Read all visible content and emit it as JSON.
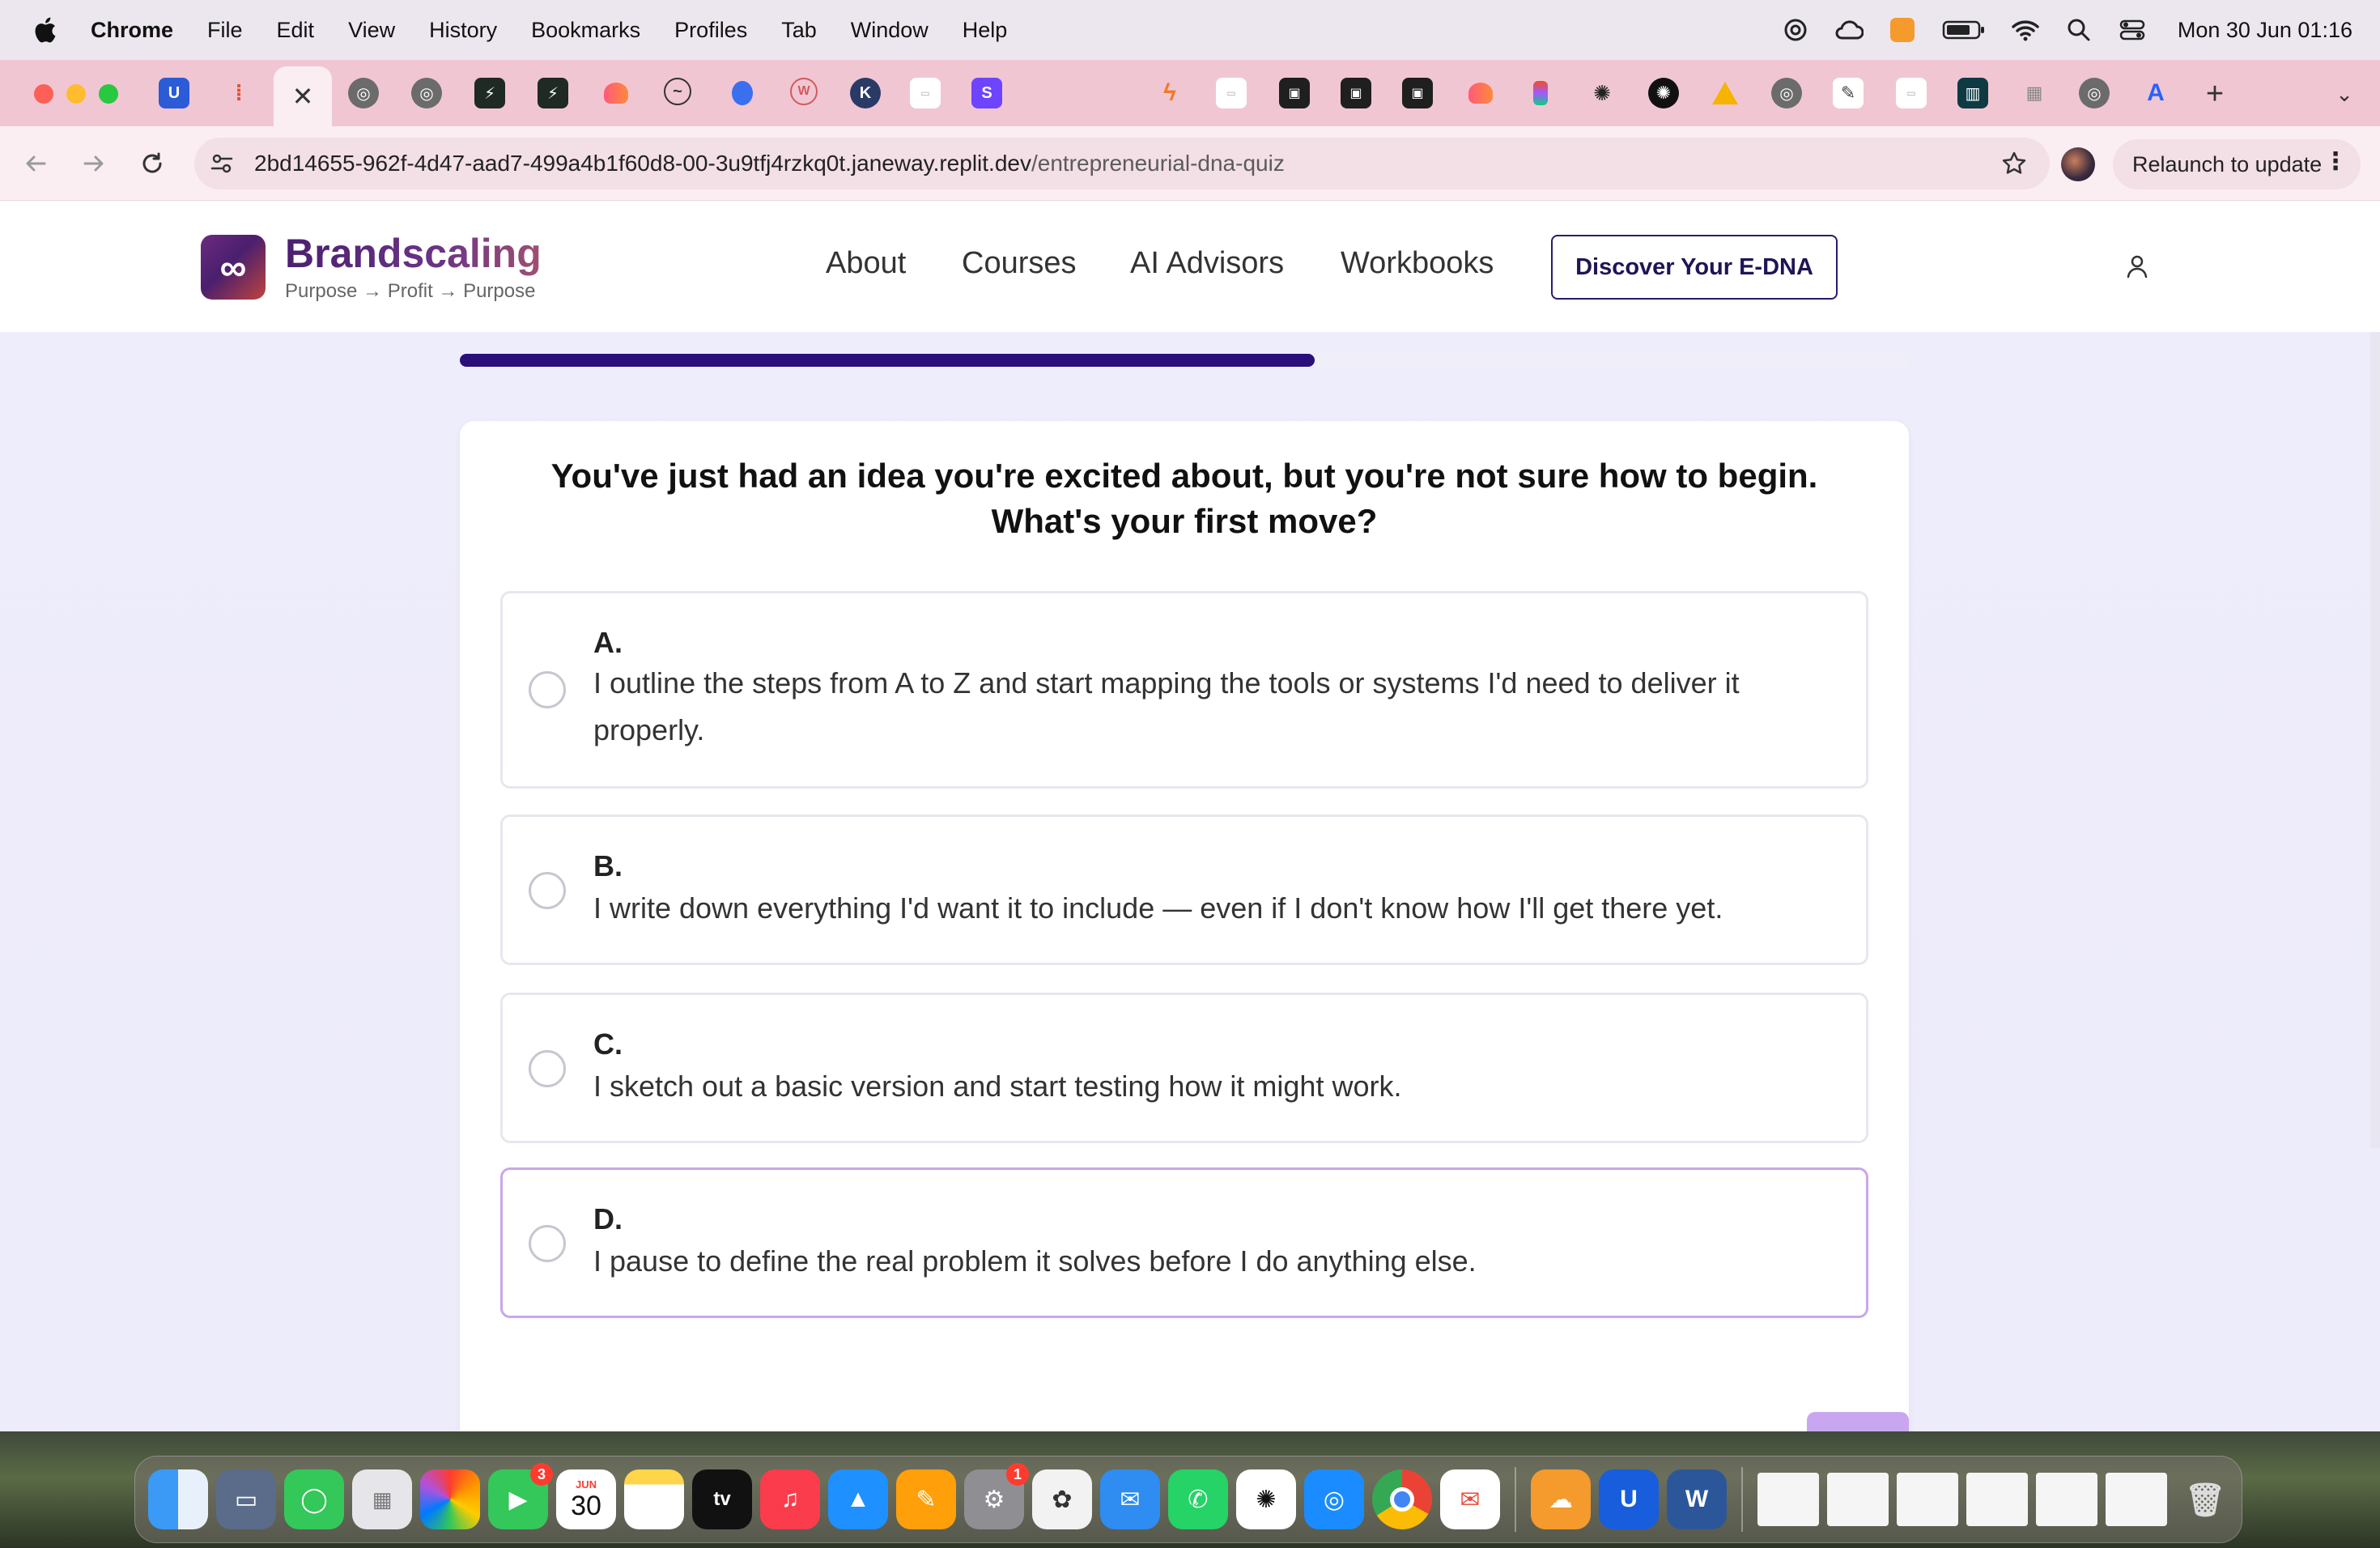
{
  "menubar": {
    "app_name": "Chrome",
    "items": [
      "File",
      "Edit",
      "View",
      "History",
      "Bookmarks",
      "Profiles",
      "Tab",
      "Window",
      "Help"
    ],
    "clock": "Mon 30 Jun  01:16"
  },
  "tabs": {
    "active_close": "✕",
    "add_label": "+",
    "menu_label": "⌄"
  },
  "toolbar": {
    "url_host": "2bd14655-962f-4d47-aad7-499a4b1f60d8-00-3u9tfj4rzkq0t.janeway.replit.dev",
    "url_path": "/entrepreneurial-dna-quiz",
    "relaunch_label": "Relaunch to update"
  },
  "site": {
    "brand": "Brandscaling",
    "tagline": "Purpose → Profit → Purpose",
    "logo_glyph": "∞",
    "nav": [
      "About",
      "Courses",
      "AI Advisors",
      "Workbooks"
    ],
    "cta": "Discover Your E-DNA",
    "accent": "#2a0f7a",
    "selected_border": "#c9a7e8"
  },
  "quiz": {
    "progress": 0.59,
    "question": "You've just had an idea you're excited about, but you're not sure how to begin. What's your first move?",
    "options": [
      {
        "letter": "A.",
        "text": "I outline the steps from A to Z and start mapping the tools or systems I'd need to deliver it properly.",
        "selected": false
      },
      {
        "letter": "B.",
        "text": "I write down everything I'd want it to include — even if I don't know how I'll get there yet.",
        "selected": false
      },
      {
        "letter": "C.",
        "text": "I sketch out a basic version and start testing how it might work.",
        "selected": false
      },
      {
        "letter": "D.",
        "text": "I pause to define the real problem it solves before I do anything else.",
        "selected": true
      }
    ]
  },
  "dock": {
    "calendar_month": "JUN",
    "calendar_day": "30",
    "facetime_badge": "3",
    "settings_badge": "1",
    "tv_label": "tv"
  }
}
